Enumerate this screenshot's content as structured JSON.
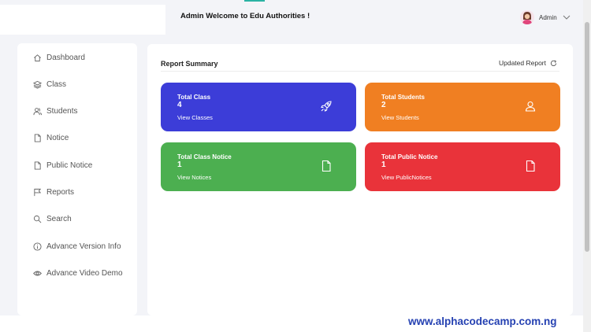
{
  "header": {
    "welcome_text": "Admin Welcome to Edu Authorities !",
    "user_name": "Admin"
  },
  "sidebar": {
    "items": [
      {
        "label": "Dashboard",
        "icon": "home-icon"
      },
      {
        "label": "Class",
        "icon": "layers-icon"
      },
      {
        "label": "Students",
        "icon": "users-icon"
      },
      {
        "label": "Notice",
        "icon": "file-icon"
      },
      {
        "label": "Public Notice",
        "icon": "file-icon"
      },
      {
        "label": "Reports",
        "icon": "flag-icon"
      },
      {
        "label": "Search",
        "icon": "search-icon"
      },
      {
        "label": "Advance Version Info",
        "icon": "info-icon"
      },
      {
        "label": "Advance Video Demo",
        "icon": "eye-icon"
      }
    ]
  },
  "main": {
    "title": "Report Summary",
    "updated_label": "Updated Report",
    "tiles": [
      {
        "title": "Total Class",
        "value": "4",
        "link": "View Classes",
        "color": "#3c3dd8",
        "icon": "rocket-icon"
      },
      {
        "title": "Total Students",
        "value": "2",
        "link": "View Students",
        "color": "#f07f22",
        "icon": "user-icon"
      },
      {
        "title": "Total Class Notice",
        "value": "1",
        "link": "View Notices",
        "color": "#4caf50",
        "icon": "file-icon"
      },
      {
        "title": "Total Public Notice",
        "value": "1",
        "link": "View PublicNotices",
        "color": "#e9333a",
        "icon": "file-icon"
      }
    ]
  },
  "watermark": "www.alphacodecamp.com.ng"
}
